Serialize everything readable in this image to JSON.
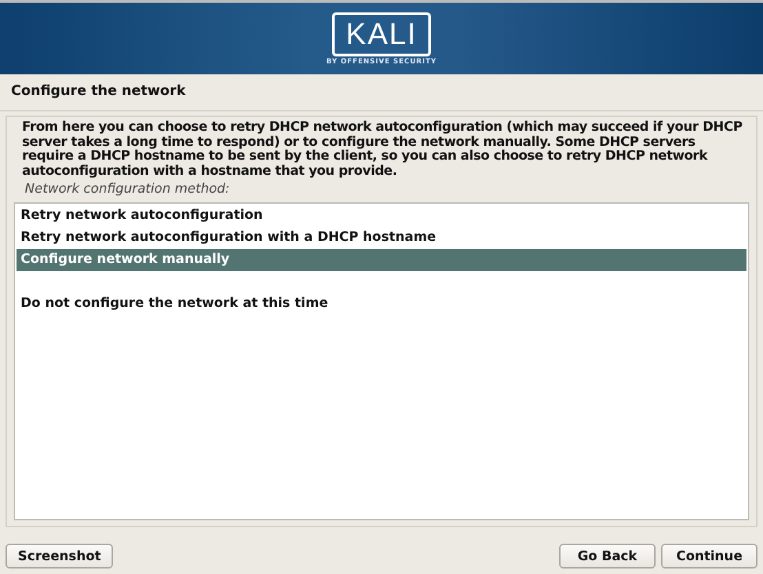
{
  "banner": {
    "logo": "KALI",
    "tagline": "BY OFFENSIVE SECURITY"
  },
  "title": "Configure the network",
  "description": "From here you can choose to retry DHCP network autoconfiguration (which may succeed if your DHCP server takes a long time to respond) or to configure the network manually. Some DHCP servers require a DHCP hostname to be sent by the client, so you can also choose to retry DHCP network autoconfiguration with a hostname that you provide.",
  "list_label": "Network configuration method:",
  "options": [
    {
      "label": "Retry network autoconfiguration",
      "selected": false,
      "kind": "plain"
    },
    {
      "label": "Retry network autoconfiguration with a DHCP hostname",
      "selected": false,
      "kind": "plain"
    },
    {
      "label": "Configure network manually",
      "selected": true,
      "kind": "plain"
    },
    {
      "label": "Do not configure the network at this time",
      "selected": false,
      "kind": "spaced"
    }
  ],
  "buttons": {
    "left": [
      "Screenshot"
    ],
    "right": [
      "Go Back",
      "Continue"
    ]
  }
}
